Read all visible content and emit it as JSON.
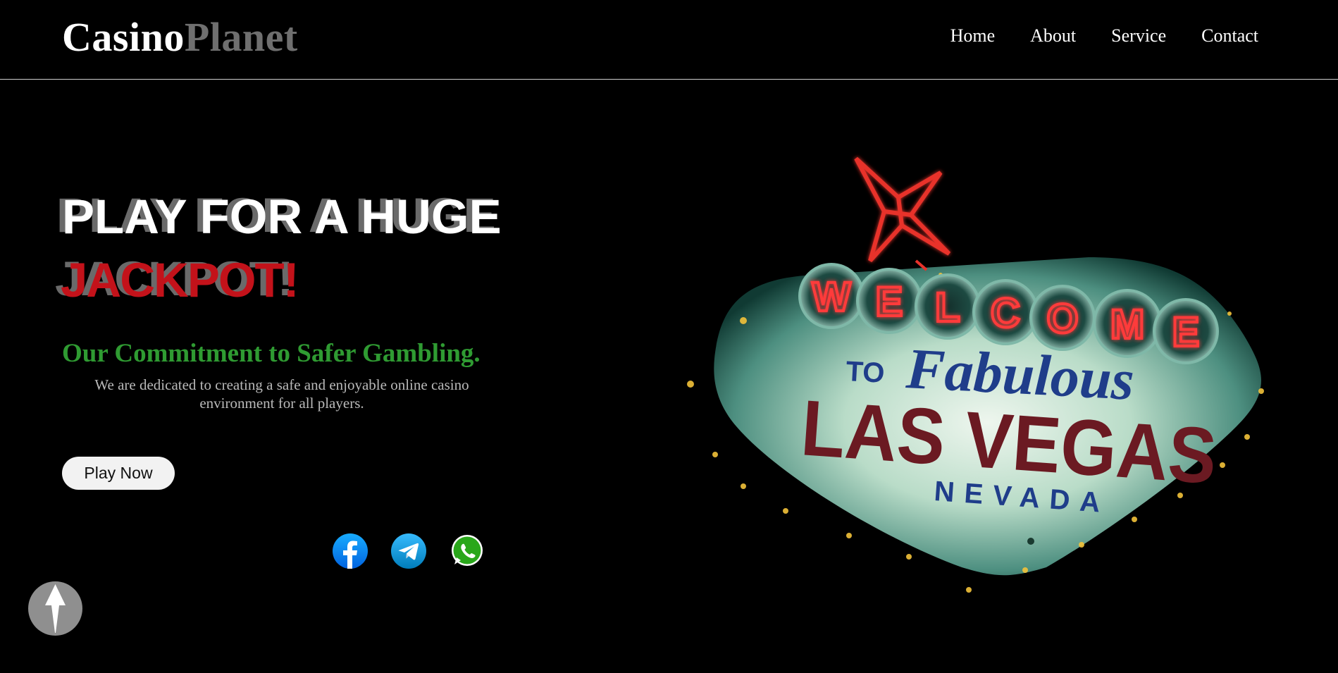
{
  "header": {
    "logo": {
      "part1": "Casino",
      "part2": "Planet"
    },
    "nav": [
      {
        "label": "Home"
      },
      {
        "label": "About"
      },
      {
        "label": "Service"
      },
      {
        "label": "Contact"
      }
    ]
  },
  "hero": {
    "headline_line1": "PLAY FOR A HUGE",
    "headline_line2": "JACKPOT!",
    "commitment_title": "Our Commitment to Safer Gambling.",
    "commitment_text": "We are dedicated to creating a safe and enjoyable online casino environment for all players.",
    "cta_label": "Play Now"
  },
  "sign": {
    "welcome": [
      "W",
      "E",
      "L",
      "C",
      "O",
      "M",
      "E"
    ],
    "to": "TO",
    "fabulous": "Fabulous",
    "city": "LAS VEGAS",
    "state": "NEVADA"
  },
  "social": [
    "facebook-icon",
    "telegram-icon",
    "whatsapp-icon"
  ],
  "colors": {
    "background": "#000000",
    "logo_accent": "#6f6f6f",
    "jackpot_red": "#c3121a",
    "commitment_green": "#2f9b32",
    "button_bg": "#f2f2f2",
    "totop_bg": "#8f8f8f"
  }
}
